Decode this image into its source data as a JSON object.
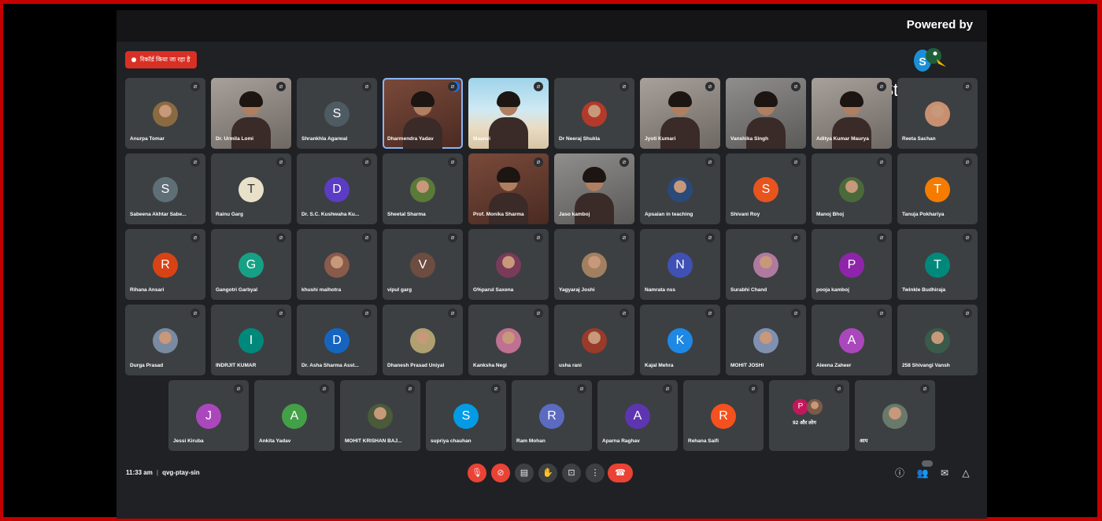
{
  "powered_by": "Powered by",
  "brand": "StreamYard",
  "recording_label": "रिकॉर्ड किया जा रहा है",
  "meeting": {
    "time": "11:33 am",
    "separator": "|",
    "code": "qvg-ptay-sin"
  },
  "colors": {
    "accent_red": "#ea4335",
    "tile_bg": "#3c4043",
    "stage_bg": "#202124",
    "active_outline": "#8ab4f8"
  },
  "rows": [
    [
      {
        "name": "Anurpa Tomar",
        "initial": "",
        "type": "photo",
        "color": "#8a6a40"
      },
      {
        "name": "Dr. Urmila Lomi",
        "initial": "",
        "type": "video",
        "style": "light"
      },
      {
        "name": "Shrankhla Agarwal",
        "initial": "S",
        "type": "initial",
        "color": "#4f5b62"
      },
      {
        "name": "Dharmendra Yadav",
        "initial": "",
        "type": "video",
        "style": "red",
        "active": true
      },
      {
        "name": "Maanvi",
        "initial": "",
        "type": "video",
        "style": "beach"
      },
      {
        "name": "Dr Neeraj Shukla",
        "initial": "",
        "type": "photo",
        "color": "#b33a2a"
      },
      {
        "name": "Jyoti Kumari",
        "initial": "",
        "type": "video",
        "style": "light"
      },
      {
        "name": "Vanshika Singh",
        "initial": "",
        "type": "video",
        "style": "gray"
      },
      {
        "name": "Aditya Kumar Maurya",
        "initial": "",
        "type": "video",
        "style": "light"
      },
      {
        "name": "Reeta Sachan",
        "initial": "",
        "type": "photo",
        "color": "#c89070"
      }
    ],
    [
      {
        "name": "Sabeena Akhtar Sabe...",
        "initial": "S",
        "type": "initial",
        "color": "#5f6f78"
      },
      {
        "name": "Rainu Garg",
        "initial": "T",
        "type": "initial",
        "color": "#e8e0c8",
        "text": "#333"
      },
      {
        "name": "Dr. S.C. Kushwaha Ku...",
        "initial": "D",
        "type": "initial",
        "color": "#5b3cc4"
      },
      {
        "name": "Sheetal Sharma",
        "initial": "",
        "type": "photo",
        "color": "#5a7a3a"
      },
      {
        "name": "Prof. Monika Sharma",
        "initial": "",
        "type": "video",
        "style": "red"
      },
      {
        "name": "Jaso kamboj",
        "initial": "",
        "type": "video",
        "style": "gray"
      },
      {
        "name": "Apsaian in teaching",
        "initial": "",
        "type": "photo",
        "color": "#2a4a7a"
      },
      {
        "name": "Shivani Roy",
        "initial": "S",
        "type": "initial",
        "color": "#e8541e"
      },
      {
        "name": "Manoj Bhoj",
        "initial": "",
        "type": "photo",
        "color": "#4a6a3a"
      },
      {
        "name": "Tanuja Pokhariya",
        "initial": "T",
        "type": "initial",
        "color": "#f57c00"
      }
    ],
    [
      {
        "name": "Rihana Ansari",
        "initial": "R",
        "type": "initial",
        "color": "#d84315"
      },
      {
        "name": "Gangotri Garbyal",
        "initial": "G",
        "type": "initial",
        "color": "#16a085"
      },
      {
        "name": "khushi malhotra",
        "initial": "",
        "type": "photo",
        "color": "#8a5a4a"
      },
      {
        "name": "vipul garg",
        "initial": "V",
        "type": "initial",
        "color": "#6d4c41"
      },
      {
        "name": "G%parul Saxena",
        "initial": "",
        "type": "photo",
        "color": "#7a3a5a"
      },
      {
        "name": "Yagyaraj Joshi",
        "initial": "",
        "type": "photo",
        "color": "#a08060"
      },
      {
        "name": "Namrata nss",
        "initial": "N",
        "type": "initial",
        "color": "#3f51b5"
      },
      {
        "name": "Surabhi Chand",
        "initial": "",
        "type": "photo",
        "color": "#b07aa0"
      },
      {
        "name": "pooja kamboj",
        "initial": "P",
        "type": "initial",
        "color": "#8e24aa"
      },
      {
        "name": "Twinkle Budhiraja",
        "initial": "T",
        "type": "initial",
        "color": "#00897b"
      }
    ],
    [
      {
        "name": "Durga Prasad",
        "initial": "",
        "type": "photo",
        "color": "#7a8aa0"
      },
      {
        "name": "INDRJIT KUMAR",
        "initial": "I",
        "type": "initial",
        "color": "#00897b"
      },
      {
        "name": "Dr. Asha Sharma Asst...",
        "initial": "D",
        "type": "initial",
        "color": "#1565c0"
      },
      {
        "name": "Dhanesh Prasad Uniyal",
        "initial": "",
        "type": "photo",
        "color": "#b0a070"
      },
      {
        "name": "Kanksha Negi",
        "initial": "",
        "type": "photo",
        "color": "#c07090"
      },
      {
        "name": "usha rani",
        "initial": "",
        "type": "photo",
        "color": "#9a3a2a"
      },
      {
        "name": "Kajal Mehra",
        "initial": "K",
        "type": "initial",
        "color": "#1e88e5"
      },
      {
        "name": "MOHIT JOSHI",
        "initial": "",
        "type": "photo",
        "color": "#8090b0"
      },
      {
        "name": "Aleena Zaheer",
        "initial": "A",
        "type": "initial",
        "color": "#ab47bc"
      },
      {
        "name": "258 Shivangi Vansh",
        "initial": "",
        "type": "photo",
        "color": "#3a5a4a"
      }
    ],
    [
      {
        "name": "Jessi Kiruba",
        "initial": "J",
        "type": "initial",
        "color": "#ab47bc"
      },
      {
        "name": "Ankita Yadav",
        "initial": "A",
        "type": "initial",
        "color": "#43a047"
      },
      {
        "name": "MOHIT KRISHAN BAJ...",
        "initial": "",
        "type": "photo",
        "color": "#4a5a3a"
      },
      {
        "name": "supriya chauhan",
        "initial": "S",
        "type": "initial",
        "color": "#039be5"
      },
      {
        "name": "Ram Mohan",
        "initial": "R",
        "type": "initial",
        "color": "#5c6bc0"
      },
      {
        "name": "Aparna Raghav",
        "initial": "A",
        "type": "initial",
        "color": "#5e35b1"
      },
      {
        "name": "Rehana Saifi",
        "initial": "R",
        "type": "initial",
        "color": "#f4511e"
      },
      {
        "name": "92 और लोग",
        "initial": "P",
        "type": "group",
        "color": "#c2185b"
      },
      {
        "name": "आप",
        "initial": "",
        "type": "photo",
        "color": "#6a7a6a"
      }
    ]
  ],
  "controls": [
    {
      "icon": "mic-off-icon",
      "glyph": "🎙",
      "red": true
    },
    {
      "icon": "camera-off-icon",
      "glyph": "⊘",
      "red": true
    },
    {
      "icon": "captions-icon",
      "glyph": "▤",
      "red": false
    },
    {
      "icon": "raise-hand-icon",
      "glyph": "✋",
      "red": false
    },
    {
      "icon": "present-screen-icon",
      "glyph": "⊡",
      "red": false
    },
    {
      "icon": "more-options-icon",
      "glyph": "⋮",
      "red": false
    }
  ],
  "end_call_glyph": "☎",
  "right_icons": [
    {
      "icon": "info-icon",
      "glyph": "ⓘ"
    },
    {
      "icon": "people-icon",
      "glyph": "👥"
    },
    {
      "icon": "chat-icon",
      "glyph": "✉"
    },
    {
      "icon": "activities-icon",
      "glyph": "△"
    }
  ]
}
